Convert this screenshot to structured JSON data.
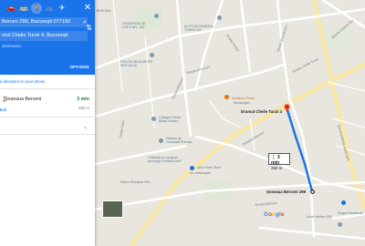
{
  "sidebar": {
    "modes": [
      "car-icon",
      "transit-icon",
      "walk-icon",
      "bike-icon",
      "plane-icon"
    ],
    "origin": "Bercen 299, București 077160",
    "destination": "ntul Chelie Turzii 4, București",
    "destination_hint": "destination",
    "options_label": "OPTIONS",
    "send_to_phone": "d directions to your phone",
    "route": {
      "via": "Șoseaua Berceni",
      "time": "3 min",
      "details_label": "ILS",
      "distance": "280 m"
    }
  },
  "map": {
    "labels": {
      "bercem": "BERCEM",
      "gradinita": "GRĂDINIȚA DE\nCOPII NR. 144",
      "alstom": "ALSTOM GENERAL\nTURBO SA",
      "politia": "POLIȚIA BUCUREȘTI\nSECȚIA 26",
      "dominos": "Domino's Pizza",
      "metalurgiei": "Metalurgiei",
      "colegiu": "Colegiul Tehnic\nMihai Viteazu",
      "fabrica": "Fabrica de\nCiocolată Primola",
      "cresa": "Crăciulța cu program\nprelungit \"Prietenii Mei\"",
      "autoparts": "Auto Parts Store",
      "metalurgiei_sub": "pe metalurgiei",
      "minex": "Minex Romania SRL",
      "arca": "Arca Hobber SRL",
      "xingra": "Xingra Residence",
      "soseaua_berceni": "Șoseaua Berceni",
      "strada_cheile_turzii": "Strada Cheile Turzii",
      "bd_berceni": "BULEVARDUL BERCENI",
      "strada_dealul": "Strada Dealul",
      "strada_brumarescu": "Strada Brumărescu",
      "strada_orlovschi": "Strada Orlovschi",
      "strada_secareni": "Strada Secăreni",
      "strada_cetatea": "Strada Cetatea Bre",
      "sos_berceni_road": "Șoseaua Berceni",
      "strada_oltenitei": "Strada Oltenitei",
      "strada_ionel": "Strada Ionel"
    },
    "origin_label": "Șoseaua Berceni 299",
    "destination_label": "Drumul Cheile Turzii 4",
    "walk_time": "3 min",
    "walk_distance": "280 m",
    "google_logo": [
      "G",
      "o",
      "o",
      "g",
      "l",
      "e"
    ]
  },
  "colors": {
    "accent": "#1a73e8",
    "route": "#1a73e8",
    "pin": "#ea4335",
    "road": "#ffffff",
    "land": "#e9e6e0"
  }
}
